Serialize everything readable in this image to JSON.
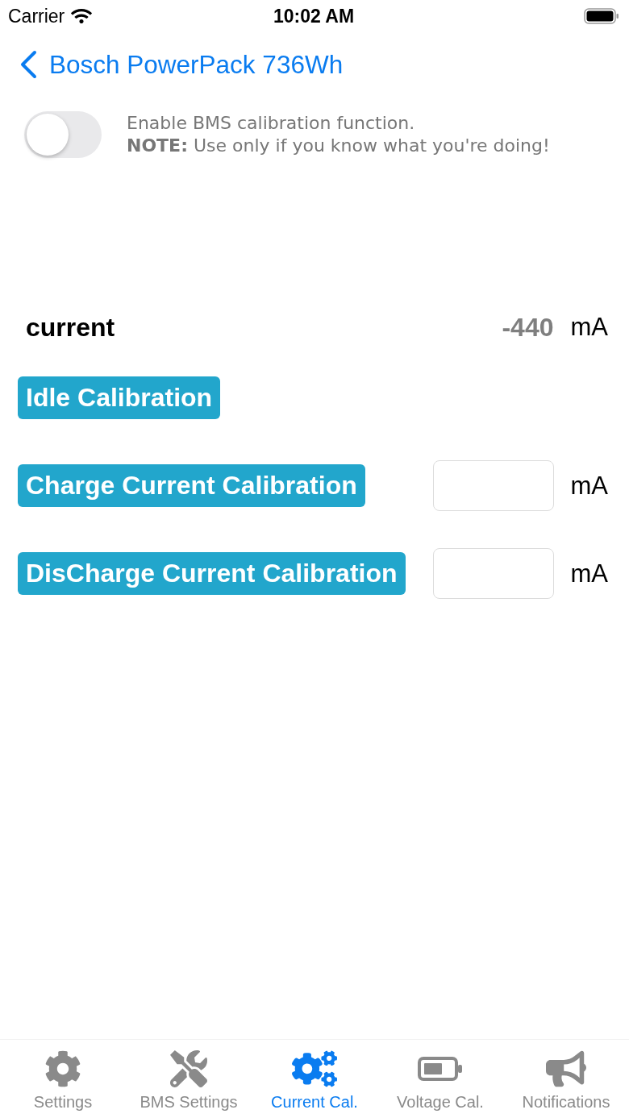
{
  "status_bar": {
    "carrier": "Carrier",
    "time": "10:02 AM"
  },
  "nav": {
    "back_title": "Bosch PowerPack 736Wh"
  },
  "calibration_toggle": {
    "on": false,
    "text": "Enable BMS calibration function.",
    "note": "**NOTE:** Use only if you know what you're doing!"
  },
  "current": {
    "label": "current",
    "value": "-440",
    "unit": "mA"
  },
  "actions": [
    {
      "kind": "button",
      "label": "Idle Calibration"
    },
    {
      "kind": "field",
      "label": "Charge Current Calibration",
      "unit": "mA"
    },
    {
      "kind": "field",
      "label": "DisCharge Current Calibration",
      "unit": "mA"
    }
  ],
  "tabs": [
    {
      "label": "Settings",
      "selected": false
    },
    {
      "label": "BMS Settings",
      "selected": false
    },
    {
      "label": "Current Cal.",
      "selected": true
    },
    {
      "label": "Voltage Cal.",
      "selected": false
    },
    {
      "label": "Notifications",
      "selected": false
    }
  ]
}
